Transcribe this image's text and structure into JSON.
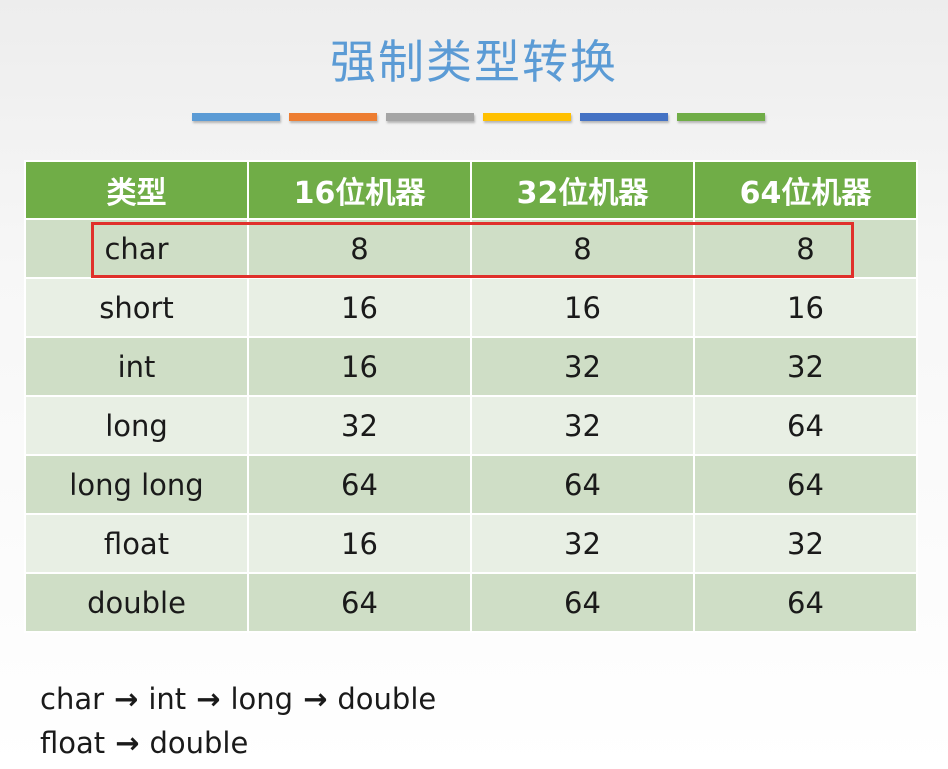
{
  "title": "强制类型转换",
  "accent_bars": [
    "#5b9bd5",
    "#ed7d31",
    "#a5a5a5",
    "#ffc000",
    "#4472c4",
    "#70ad47"
  ],
  "table": {
    "headers": [
      "类型",
      "16位机器",
      "32位机器",
      "64位机器"
    ],
    "rows": [
      [
        "char",
        "8",
        "8",
        "8"
      ],
      [
        "short",
        "16",
        "16",
        "16"
      ],
      [
        "int",
        "16",
        "32",
        "32"
      ],
      [
        "long",
        "32",
        "32",
        "64"
      ],
      [
        "long long",
        "64",
        "64",
        "64"
      ],
      [
        "float",
        "16",
        "32",
        "32"
      ],
      [
        "double",
        "64",
        "64",
        "64"
      ]
    ],
    "highlighted_row": "char",
    "header_color": "#70ad47",
    "highlight_color": "#e0302b"
  },
  "conversion_chains": [
    [
      "char",
      "int",
      "long",
      "double"
    ],
    [
      "float",
      "double"
    ]
  ]
}
